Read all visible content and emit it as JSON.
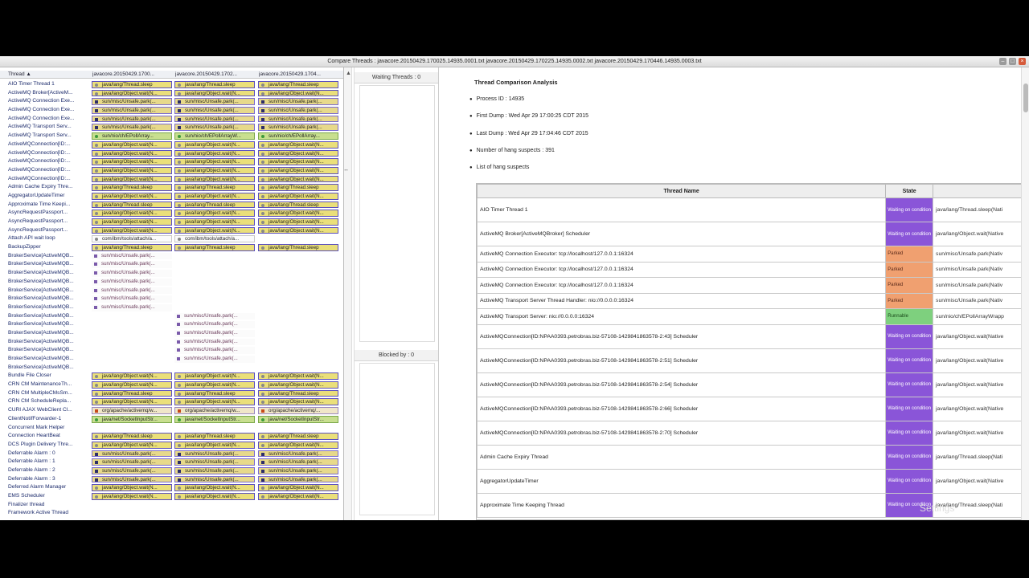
{
  "window": {
    "title": "Compare Threads : javacore.20150429.170025.14935.0001.txt javacore.20150429.170225.14935.0002.txt javacore.20150429.170446.14935.0003.txt"
  },
  "left": {
    "col_thread": "Thread ▲",
    "col_dumps": [
      "javacore.20150429.1700...",
      "javacore.20150429.1702...",
      "javacore.20150429.1704..."
    ],
    "threads": [
      "AIO Timer Thread 1",
      "ActiveMQ Broker[ActiveM...",
      "ActiveMQ Connection Exe...",
      "ActiveMQ Connection Exe...",
      "ActiveMQ Connection Exe...",
      "ActiveMQ Transport Serv...",
      "ActiveMQ Transport Serv...",
      "ActiveMQConnection[ID:...",
      "ActiveMQConnection[ID:...",
      "ActiveMQConnection[ID:...",
      "ActiveMQConnection[ID:...",
      "ActiveMQConnection[ID:...",
      "Admin Cache Expiry Thre...",
      "AggregatorUpdateTimer",
      "Approximate Time Keepi...",
      "AsyncRequestPassport...",
      "AsyncRequestPassport...",
      "AsyncRequestPassport...",
      "Attach API wait loop",
      "BackupZipper",
      "BrokerService[ActiveMQB...",
      "BrokerService[ActiveMQB...",
      "BrokerService[ActiveMQB...",
      "BrokerService[ActiveMQB...",
      "BrokerService[ActiveMQB...",
      "BrokerService[ActiveMQB...",
      "BrokerService[ActiveMQB...",
      "BrokerService[ActiveMQB...",
      "BrokerService[ActiveMQB...",
      "BrokerService[ActiveMQB...",
      "BrokerService[ActiveMQB...",
      "BrokerService[ActiveMQB...",
      "BrokerService[ActiveMQB...",
      "BrokerService[ActiveMQB...",
      "Bundle File Closer",
      "CRN CM MaintenanceTh...",
      "CRN CM MultipleCMsSm...",
      "CRN CM ScheduleRepla...",
      "CURI AJAX WebClient Cl...",
      "ClientNotifForwarder-1",
      "Concurrent Mark Helper",
      "Connection HeartBeat",
      "DCS Plugin Delivery Thre...",
      "Deferrable Alarm : 0",
      "Deferrable Alarm : 1",
      "Deferrable Alarm : 2",
      "Deferrable Alarm : 3",
      "Deferred Alarm Manager",
      "EMS Scheduler",
      "Finalizer thread",
      "Framework Active Thread"
    ],
    "cells": [
      [
        "w:java/lang/Thread.sleep",
        "w:java/lang/Thread.sleep",
        "w:java/lang/Thread.sleep"
      ],
      [
        "w:java/lang/Object.wait(N...",
        "w:java/lang/Object.wait(N...",
        "w:java/lang/Object.wait(N..."
      ],
      [
        "p:sun/misc/Unsafe.park(...",
        "p:sun/misc/Unsafe.park(...",
        "p:sun/misc/Unsafe.park(..."
      ],
      [
        "p:sun/misc/Unsafe.park(...",
        "p:sun/misc/Unsafe.park(...",
        "p:sun/misc/Unsafe.park(..."
      ],
      [
        "p:sun/misc/Unsafe.park(...",
        "p:sun/misc/Unsafe.park(...",
        "p:sun/misc/Unsafe.park(..."
      ],
      [
        "p:sun/misc/Unsafe.park(...",
        "p:sun/misc/Unsafe.park(...",
        "p:sun/misc/Unsafe.park(..."
      ],
      [
        "r:sun/nio/ch/EPollArray...",
        "r:sun/nio/ch/EPollArrayW...",
        "r:sun/nio/ch/EPollArray..."
      ],
      [
        "w:java/lang/Object.wait(N...",
        "w:java/lang/Object.wait(N...",
        "w:java/lang/Object.wait(N..."
      ],
      [
        "w:java/lang/Object.wait(N...",
        "w:java/lang/Object.wait(N...",
        "w:java/lang/Object.wait(N..."
      ],
      [
        "w:java/lang/Object.wait(N...",
        "w:java/lang/Object.wait(N...",
        "w:java/lang/Object.wait(N..."
      ],
      [
        "w:java/lang/Object.wait(N...",
        "w:java/lang/Object.wait(N...",
        "w:java/lang/Object.wait(N..."
      ],
      [
        "w:java/lang/Object.wait(N...",
        "w:java/lang/Object.wait(N...",
        "w:java/lang/Object.wait(N..."
      ],
      [
        "w:java/lang/Thread.sleep",
        "w:java/lang/Thread.sleep",
        "w:java/lang/Thread.sleep"
      ],
      [
        "w:java/lang/Object.wait(N...",
        "w:java/lang/Object.wait(N...",
        "w:java/lang/Object.wait(N..."
      ],
      [
        "w:java/lang/Thread.sleep",
        "w:java/lang/Thread.sleep",
        "w:java/lang/Thread.sleep"
      ],
      [
        "w:java/lang/Object.wait(N...",
        "w:java/lang/Object.wait(N...",
        "w:java/lang/Object.wait(N..."
      ],
      [
        "w:java/lang/Object.wait(N...",
        "w:java/lang/Object.wait(N...",
        "w:java/lang/Object.wait(N..."
      ],
      [
        "w:java/lang/Object.wait(N...",
        "w:java/lang/Object.wait(N...",
        "w:java/lang/Object.wait(N..."
      ],
      [
        "l:com/ibm/tools/attach/a...",
        "l:com/ibm/tools/attach/a...",
        "e:"
      ],
      [
        "w:java/lang/Thread.sleep",
        "w:java/lang/Thread.sleep",
        "w:java/lang/Thread.sleep"
      ],
      [
        "pk:sun/misc/Unsafe.park(...",
        "e:",
        "e:"
      ],
      [
        "pk:sun/misc/Unsafe.park(...",
        "e:",
        "e:"
      ],
      [
        "pk:sun/misc/Unsafe.park(...",
        "e:",
        "e:"
      ],
      [
        "pk:sun/misc/Unsafe.park(...",
        "e:",
        "e:"
      ],
      [
        "pk:sun/misc/Unsafe.park(...",
        "e:",
        "e:"
      ],
      [
        "pk:sun/misc/Unsafe.park(...",
        "e:",
        "e:"
      ],
      [
        "pk:sun/misc/Unsafe.park(...",
        "e:",
        "e:"
      ],
      [
        "e:",
        "pk:sun/misc/Unsafe.park(...",
        "e:"
      ],
      [
        "e:",
        "pk:sun/misc/Unsafe.park(...",
        "e:"
      ],
      [
        "e:",
        "pk:sun/misc/Unsafe.park(...",
        "e:"
      ],
      [
        "e:",
        "pk:sun/misc/Unsafe.park(...",
        "e:"
      ],
      [
        "e:",
        "pk:sun/misc/Unsafe.park(...",
        "e:"
      ],
      [
        "e:",
        "pk:sun/misc/Unsafe.park(...",
        "e:"
      ],
      [
        "e:",
        "e:",
        "e:"
      ],
      [
        "w:java/lang/Object.wait(N...",
        "w:java/lang/Object.wait(N...",
        "w:java/lang/Object.wait(N..."
      ],
      [
        "w:java/lang/Object.wait(N...",
        "w:java/lang/Object.wait(N...",
        "w:java/lang/Object.wait(N..."
      ],
      [
        "w:java/lang/Thread.sleep",
        "w:java/lang/Thread.sleep",
        "w:java/lang/Thread.sleep"
      ],
      [
        "w:java/lang/Object.wait(N...",
        "w:java/lang/Object.wait(N...",
        "w:java/lang/Object.wait(N..."
      ],
      [
        "o:org/apache/activemq/w...",
        "o:org/apache/activemq/w...",
        "o:org/apache/activemq/..."
      ],
      [
        "r:java/net/SocketInputStr...",
        "r:java/net/SocketInputStr...",
        "r:java/net/SocketInputStr..."
      ],
      [
        "e:",
        "e:",
        "e:"
      ],
      [
        "w:java/lang/Thread.sleep",
        "w:java/lang/Thread.sleep",
        "w:java/lang/Thread.sleep"
      ],
      [
        "w:java/lang/Object.wait(N...",
        "w:java/lang/Object.wait(N...",
        "w:java/lang/Object.wait(N..."
      ],
      [
        "p:sun/misc/Unsafe.park(...",
        "p:sun/misc/Unsafe.park(...",
        "p:sun/misc/Unsafe.park(..."
      ],
      [
        "p:sun/misc/Unsafe.park(...",
        "p:sun/misc/Unsafe.park(...",
        "p:sun/misc/Unsafe.park(..."
      ],
      [
        "p:sun/misc/Unsafe.park(...",
        "p:sun/misc/Unsafe.park(...",
        "p:sun/misc/Unsafe.park(..."
      ],
      [
        "p:sun/misc/Unsafe.park(...",
        "p:sun/misc/Unsafe.park(...",
        "p:sun/misc/Unsafe.park(..."
      ],
      [
        "w:java/lang/Object.wait(N...",
        "w:java/lang/Object.wait(N...",
        "w:java/lang/Object.wait(N..."
      ],
      [
        "w:java/lang/Object.wait(N...",
        "w:java/lang/Object.wait(N...",
        "w:java/lang/Object.wait(N..."
      ],
      [
        "e:",
        "e:",
        "e:"
      ],
      [
        "e:",
        "e:",
        "e:"
      ]
    ]
  },
  "middle": {
    "waiting_label": "Waiting Threads : 0",
    "blocked_label": "Blocked by : 0"
  },
  "analysis": {
    "title": "Thread Comparison Analysis",
    "process_id": "Process ID : 14935",
    "first_dump": "First Dump : Wed Apr 29 17:00:25 CDT 2015",
    "last_dump": "Last Dump : Wed Apr 29 17:04:46 CDT 2015",
    "hang_count": "Number of hang suspects : 391",
    "list_label": "List of hang suspects",
    "headers": [
      "Thread Name",
      "State",
      ""
    ],
    "rows": [
      {
        "name": "AIO Timer Thread 1",
        "state": "Waiting on condition",
        "cls": "st-wait",
        "stack": "java/lang/Thread.sleep(Nati",
        "short": false
      },
      {
        "name": "ActiveMQ Broker[ActiveMQBroker] Scheduler",
        "state": "Waiting on condition",
        "cls": "st-wait",
        "stack": "java/lang/Object.wait(Native",
        "short": false
      },
      {
        "name": "ActiveMQ Connection Executor: tcp://localhost/127.0.0.1:16324",
        "state": "Parked",
        "cls": "st-park",
        "stack": "sun/misc/Unsafe.park(Nativ",
        "short": true
      },
      {
        "name": "ActiveMQ Connection Executor: tcp://localhost/127.0.0.1:16324",
        "state": "Parked",
        "cls": "st-park",
        "stack": "sun/misc/Unsafe.park(Nativ",
        "short": true
      },
      {
        "name": "ActiveMQ Connection Executor: tcp://localhost/127.0.0.1:16324",
        "state": "Parked",
        "cls": "st-park",
        "stack": "sun/misc/Unsafe.park(Nativ",
        "short": true
      },
      {
        "name": "ActiveMQ Transport Server Thread Handler: nio://0.0.0.0:16324",
        "state": "Parked",
        "cls": "st-park",
        "stack": "sun/misc/Unsafe.park(Nativ",
        "short": true
      },
      {
        "name": "ActiveMQ Transport Server: nio://0.0.0.0:16324",
        "state": "Runnable",
        "cls": "st-run",
        "stack": "sun/nio/ch/EPollArrayWrapp",
        "short": true
      },
      {
        "name": "ActiveMQConnection[ID:NPAA0393.petrobras.biz-57108-1429841863578-2:43] Scheduler",
        "state": "Waiting on condition",
        "cls": "st-wait",
        "stack": "java/lang/Object.wait(Native",
        "short": false
      },
      {
        "name": "ActiveMQConnection[ID:NPAA0393.petrobras.biz-57108-1429841863578-2:51] Scheduler",
        "state": "Waiting on condition",
        "cls": "st-wait",
        "stack": "java/lang/Object.wait(Native",
        "short": false
      },
      {
        "name": "ActiveMQConnection[ID:NPAA0393.petrobras.biz-57108-1429841863578-2:54] Scheduler",
        "state": "Waiting on condition",
        "cls": "st-wait",
        "stack": "java/lang/Object.wait(Native",
        "short": false
      },
      {
        "name": "ActiveMQConnection[ID:NPAA0393.petrobras.biz-57108-1429841863578-2:66] Scheduler",
        "state": "Waiting on condition",
        "cls": "st-wait",
        "stack": "java/lang/Object.wait(Native",
        "short": false
      },
      {
        "name": "ActiveMQConnection[ID:NPAA0393.petrobras.biz-57108-1429841863578-2:70] Scheduler",
        "state": "Waiting on condition",
        "cls": "st-wait",
        "stack": "java/lang/Object.wait(Native",
        "short": false
      },
      {
        "name": "Admin Cache Expiry Thread",
        "state": "Waiting on condition",
        "cls": "st-wait",
        "stack": "java/lang/Thread.sleep(Nati",
        "short": false
      },
      {
        "name": "AggregatorUpdateTimer",
        "state": "Waiting on condition",
        "cls": "st-wait",
        "stack": "java/lang/Object.wait(Native",
        "short": false
      },
      {
        "name": "Approximate Time Keeping Thread",
        "state": "Waiting on condition",
        "cls": "st-wait",
        "stack": "java/lang/Thread.sleep(Nati",
        "short": false
      }
    ]
  },
  "overlay": {
    "settings": "Settings"
  }
}
